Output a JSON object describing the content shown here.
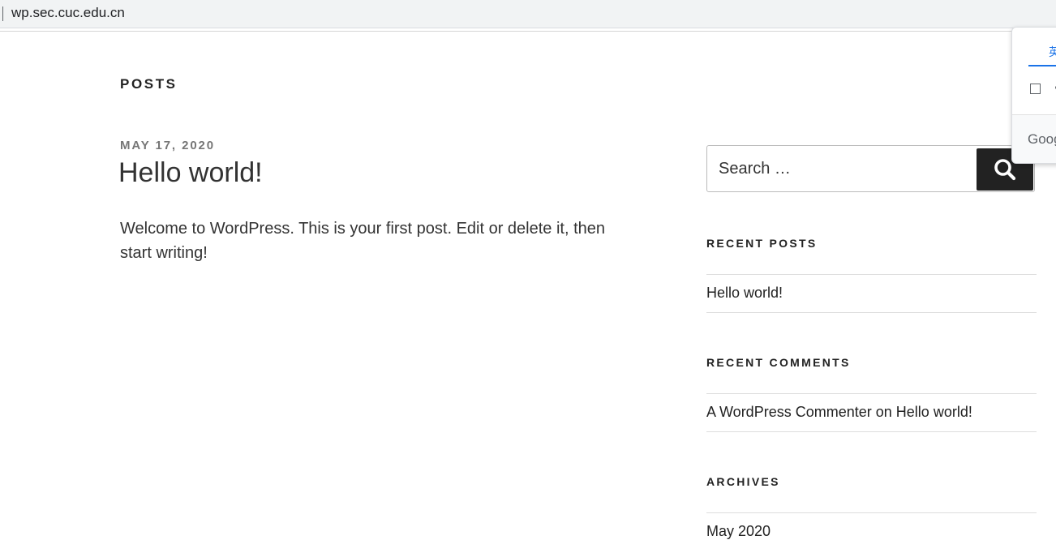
{
  "browser": {
    "url": "wp.sec.cuc.edu.cn"
  },
  "page": {
    "title": "POSTS"
  },
  "post": {
    "date": "MAY 17, 2020",
    "title": "Hello world!",
    "excerpt": "Welcome to WordPress. This is your first post. Edit or delete it, then start writing!"
  },
  "sidebar": {
    "search": {
      "placeholder": "Search …",
      "button_icon": "search-icon"
    },
    "recent_posts": {
      "title": "RECENT POSTS",
      "items": [
        "Hello world!"
      ]
    },
    "recent_comments": {
      "title": "RECENT COMMENTS",
      "items": [
        {
          "author": "A WordPress Commenter",
          "connector": "on",
          "post": "Hello world!"
        }
      ]
    },
    "archives": {
      "title": "ARCHIVES",
      "items": [
        "May 2020"
      ]
    }
  },
  "translate_popup": {
    "tab_label": "英",
    "brand": "Google"
  },
  "colors": {
    "text": "#222222",
    "muted": "#767676",
    "button_bg": "#222222",
    "accent_blue": "#1a73e8"
  }
}
